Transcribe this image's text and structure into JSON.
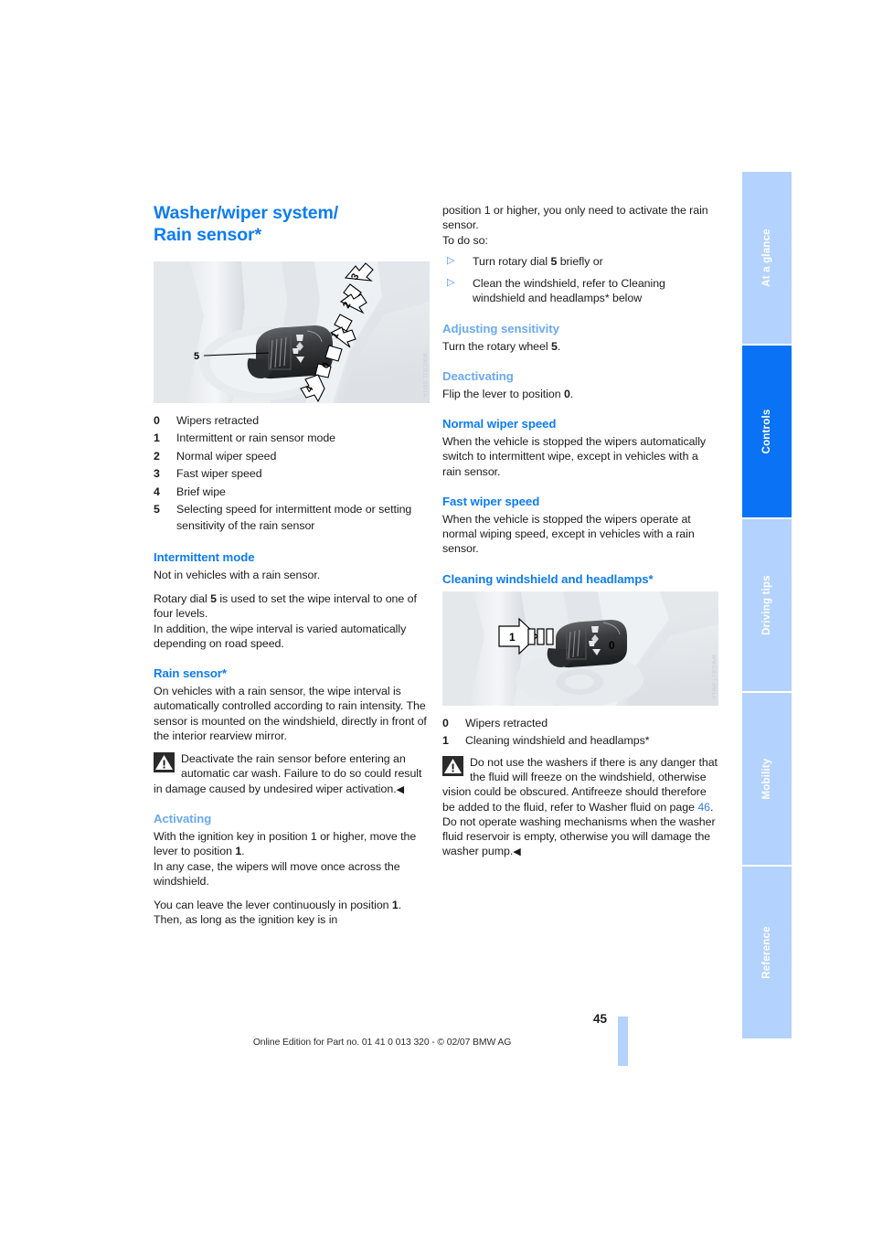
{
  "page": {
    "number": "45",
    "footer": "Online Edition for Part no. 01 41 0 013 320 - © 02/07 BMW AG"
  },
  "tabs": [
    {
      "label": "At a glance",
      "active": false
    },
    {
      "label": "Controls",
      "active": true
    },
    {
      "label": "Driving tips",
      "active": false
    },
    {
      "label": "Mobility",
      "active": false
    },
    {
      "label": "Reference",
      "active": false
    }
  ],
  "colors": {
    "heading_blue": "#0d7cf2",
    "pale_heading_blue": "#6aa9f5",
    "tab_light": "#b3d2fd",
    "tab_active": "#0a72f5"
  },
  "left": {
    "title_line1": "Washer/wiper system/",
    "title_line2": "Rain sensor*",
    "figure_watermark": "WWCB11.0M1A",
    "legend": [
      {
        "num": "0",
        "text": "Wipers retracted"
      },
      {
        "num": "1",
        "text": "Intermittent or rain sensor mode"
      },
      {
        "num": "2",
        "text": "Normal wiper speed"
      },
      {
        "num": "3",
        "text": "Fast wiper speed"
      },
      {
        "num": "4",
        "text": "Brief wipe"
      },
      {
        "num": "5",
        "text": "Selecting speed for intermittent mode or setting sensitivity of the rain sensor"
      }
    ],
    "intermittent_heading": "Intermittent mode",
    "intermittent_p1": "Not in vehicles with a rain sensor.",
    "intermittent_p2_a": "Rotary dial ",
    "intermittent_p2_b": "5",
    "intermittent_p2_c": " is used to set the wipe interval to one of four levels.",
    "intermittent_p3": "In addition, the wipe interval is varied automatically depending on road speed.",
    "rain_heading": "Rain sensor*",
    "rain_p1": "On vehicles with a rain sensor, the wipe interval is automatically controlled according to rain intensity. The sensor is mounted on the windshield, directly in front of the interior rearview mirror.",
    "rain_warning": "Deactivate the rain sensor before entering an automatic car wash. Failure to do so could result in damage caused by undesired wiper activation.",
    "activating_heading": "Activating",
    "activating_p1_a": "With the ignition key in position 1 or higher, move the lever to position ",
    "activating_p1_b": "1",
    "activating_p1_c": ".",
    "activating_p2": "In any case, the wipers will move once across the windshield.",
    "activating_p3_a": "You can leave the lever continuously in position ",
    "activating_p3_b": "1",
    "activating_p3_c": ". Then, as long as the ignition key is in"
  },
  "right": {
    "cont_p1": "position 1 or higher, you only need to activate the rain sensor.",
    "cont_p2": "To do so:",
    "bullets": [
      {
        "marker": "triangle-bullet-icon",
        "text_a": "Turn rotary dial ",
        "text_b": "5",
        "text_c": " briefly or"
      },
      {
        "marker": "triangle-bullet-icon",
        "text_a": "Clean the windshield, refer to Cleaning windshield and headlamps* below",
        "text_b": "",
        "text_c": ""
      }
    ],
    "adjusting_heading": "Adjusting sensitivity",
    "adjusting_p_a": "Turn the rotary wheel ",
    "adjusting_p_b": "5",
    "adjusting_p_c": ".",
    "deactivating_heading": "Deactivating",
    "deactivating_p_a": "Flip the lever to position ",
    "deactivating_p_b": "0",
    "deactivating_p_c": ".",
    "normal_heading": "Normal wiper speed",
    "normal_p": "When the vehicle is stopped the wipers automatically switch to intermittent wipe, except in vehicles with a rain sensor.",
    "fast_heading": "Fast wiper speed",
    "fast_p": "When the vehicle is stopped the wipers operate at normal wiping speed, except in vehicles with a rain sensor.",
    "cleaning_heading": "Cleaning windshield and headlamps*",
    "figure_watermark": "WWCB17.0M1A",
    "legend": [
      {
        "num": "0",
        "text": "Wipers retracted"
      },
      {
        "num": "1",
        "text": "Cleaning windshield and headlamps*"
      }
    ],
    "warning_a": "Do not use the washers if there is any danger that the fluid will freeze on the windshield, otherwise vision could be obscured. Antifreeze should therefore be added to the fluid, refer to Washer fluid on page ",
    "warning_page": "46",
    "warning_b": ".",
    "warning_c": "Do not operate washing mechanisms when the washer fluid reservoir is empty, otherwise you will damage the washer pump."
  }
}
